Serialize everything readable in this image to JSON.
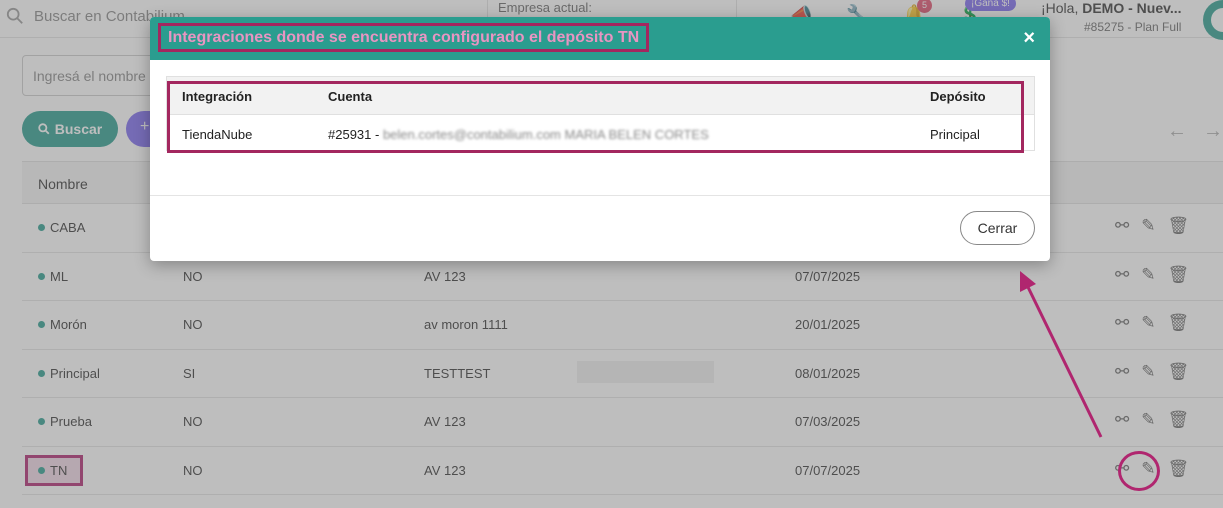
{
  "topbar": {
    "search_placeholder": "Buscar en Contabilium",
    "company_label": "Empresa actual:",
    "notif_count": "5",
    "promo_label": "¡Ganá $!",
    "greeting_prefix": "¡Hola, ",
    "greeting_user": "DEMO - Nuev...",
    "plan": "#85275 - Plan Full"
  },
  "filters": {
    "name_placeholder": "Ingresá el nombre",
    "search_button": "Buscar",
    "add_button": "+"
  },
  "table": {
    "header_name": "Nombre",
    "rows": [
      {
        "name": "CABA",
        "principal": "",
        "address": "",
        "date": ""
      },
      {
        "name": "ML",
        "principal": "NO",
        "address": "AV 123",
        "date": "07/07/2025"
      },
      {
        "name": "Morón",
        "principal": "NO",
        "address": "av moron 1111",
        "date": "20/01/2025"
      },
      {
        "name": "Principal",
        "principal": "SI",
        "address": "TESTTEST",
        "date": "08/01/2025"
      },
      {
        "name": "Prueba",
        "principal": "NO",
        "address": "AV 123",
        "date": "07/03/2025"
      },
      {
        "name": "TN",
        "principal": "NO",
        "address": "AV 123",
        "date": "07/07/2025"
      }
    ]
  },
  "modal": {
    "title": "Integraciones donde se encuentra configurado el depósito TN",
    "close_icon": "×",
    "columns": {
      "integration": "Integración",
      "account": "Cuenta",
      "warehouse": "Depósito"
    },
    "rows": [
      {
        "integration": "TiendaNube",
        "account_id": "#25931 - ",
        "account_email": "belen.cortes@contabilium.com MARIA BELEN CORTES",
        "warehouse": "Principal"
      }
    ],
    "close_button": "Cerrar"
  },
  "colors": {
    "accent": "#2a9d8f",
    "highlight": "#a3275f",
    "secondary": "#7b68ee"
  }
}
